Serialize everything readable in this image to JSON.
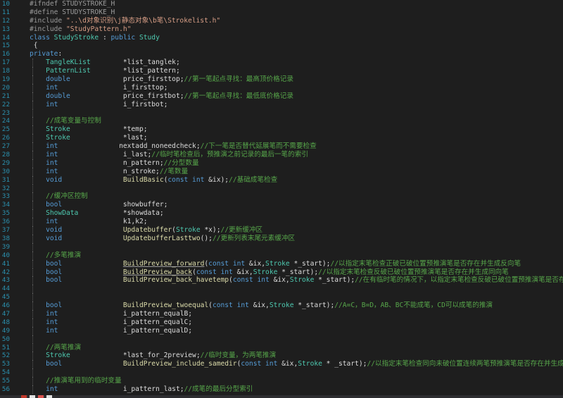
{
  "editor": {
    "lines": [
      {
        "num": "10",
        "guides": [],
        "tokens": [
          [
            "t-pp",
            "#ifndef STUDYSTROKE_H"
          ]
        ]
      },
      {
        "num": "11",
        "guides": [],
        "tokens": [
          [
            "t-pp",
            "#define STUDYSTROKE_H"
          ]
        ]
      },
      {
        "num": "12",
        "guides": [],
        "tokens": [
          [
            "t-pp",
            "#include "
          ],
          [
            "t-str",
            "\"..\\d对象识别\\j静态对象\\b笔\\Strokelist.h\""
          ]
        ]
      },
      {
        "num": "13",
        "guides": [],
        "tokens": [
          [
            "t-pp",
            "#include "
          ],
          [
            "t-str",
            "\"StudyPattern.h\""
          ]
        ]
      },
      {
        "num": "14",
        "guides": [],
        "tokens": [
          [
            "t-kw",
            "class "
          ],
          [
            "t-type",
            "StudyStroke"
          ],
          [
            "t-plain",
            " : "
          ],
          [
            "t-kw",
            "public "
          ],
          [
            "t-type",
            "Study"
          ]
        ]
      },
      {
        "num": "15",
        "guides": [],
        "tokens": [
          [
            "t-plain",
            " {"
          ]
        ]
      },
      {
        "num": "16",
        "guides": [],
        "tokens": [
          [
            "t-kw",
            "private"
          ],
          [
            "t-plain",
            ":"
          ]
        ]
      },
      {
        "num": "17",
        "guides": [
          1
        ],
        "tokens": [
          [
            "t-plain",
            "    "
          ],
          [
            "t-type",
            "TangleKList"
          ],
          [
            "t-plain",
            "        *list_tanglek;"
          ]
        ]
      },
      {
        "num": "18",
        "guides": [
          1
        ],
        "tokens": [
          [
            "t-plain",
            "    "
          ],
          [
            "t-type",
            "PatternList"
          ],
          [
            "t-plain",
            "        *list_pattern;"
          ]
        ]
      },
      {
        "num": "19",
        "guides": [
          1
        ],
        "tokens": [
          [
            "t-plain",
            "    "
          ],
          [
            "t-kw",
            "double"
          ],
          [
            "t-plain",
            "             price_firsttop;"
          ],
          [
            "t-cmt",
            "//第一笔起点寻找：最高顶价格记录"
          ]
        ]
      },
      {
        "num": "20",
        "guides": [
          1
        ],
        "tokens": [
          [
            "t-plain",
            "    "
          ],
          [
            "t-kw",
            "int"
          ],
          [
            "t-plain",
            "                i_firsttop;"
          ]
        ]
      },
      {
        "num": "21",
        "guides": [
          1
        ],
        "tokens": [
          [
            "t-plain",
            "    "
          ],
          [
            "t-kw",
            "double"
          ],
          [
            "t-plain",
            "             price_firstbot;"
          ],
          [
            "t-cmt",
            "//第一笔起点寻找：最低底价格记录"
          ]
        ]
      },
      {
        "num": "22",
        "guides": [
          1
        ],
        "tokens": [
          [
            "t-plain",
            "    "
          ],
          [
            "t-kw",
            "int"
          ],
          [
            "t-plain",
            "                i_firstbot;"
          ]
        ]
      },
      {
        "num": "23",
        "guides": [
          1
        ],
        "tokens": []
      },
      {
        "num": "24",
        "guides": [
          1
        ],
        "tokens": [
          [
            "t-plain",
            "    "
          ],
          [
            "t-cmt",
            "//成笔变量与控制"
          ]
        ]
      },
      {
        "num": "25",
        "guides": [
          1
        ],
        "tokens": [
          [
            "t-plain",
            "    "
          ],
          [
            "t-type",
            "Stroke"
          ],
          [
            "t-plain",
            "             *temp;"
          ]
        ]
      },
      {
        "num": "26",
        "guides": [
          1
        ],
        "tokens": [
          [
            "t-plain",
            "    "
          ],
          [
            "t-type",
            "Stroke"
          ],
          [
            "t-plain",
            "             *last;"
          ]
        ]
      },
      {
        "num": "27",
        "guides": [
          1
        ],
        "tokens": [
          [
            "t-plain",
            "    "
          ],
          [
            "t-kw",
            "int"
          ],
          [
            "t-plain",
            "               nextadd_noneedcheck;"
          ],
          [
            "t-cmt",
            "//下一笔是否替代延展笔而不需要检查"
          ]
        ]
      },
      {
        "num": "28",
        "guides": [
          1
        ],
        "tokens": [
          [
            "t-plain",
            "    "
          ],
          [
            "t-kw",
            "int"
          ],
          [
            "t-plain",
            "                i_last;"
          ],
          [
            "t-cmt",
            "//临时笔检查后，预推演之前记录的最后一笔的索引"
          ]
        ]
      },
      {
        "num": "29",
        "guides": [
          1
        ],
        "tokens": [
          [
            "t-plain",
            "    "
          ],
          [
            "t-kw",
            "int"
          ],
          [
            "t-plain",
            "                n_pattern;"
          ],
          [
            "t-cmt",
            "//分型数量"
          ]
        ]
      },
      {
        "num": "30",
        "guides": [
          1
        ],
        "tokens": [
          [
            "t-plain",
            "    "
          ],
          [
            "t-kw",
            "int"
          ],
          [
            "t-plain",
            "                n_stroke;"
          ],
          [
            "t-cmt",
            "//笔数量"
          ]
        ]
      },
      {
        "num": "31",
        "guides": [
          1
        ],
        "tokens": [
          [
            "t-plain",
            "    "
          ],
          [
            "t-kw",
            "void"
          ],
          [
            "t-plain",
            "               "
          ],
          [
            "t-fn",
            "BuildBasic"
          ],
          [
            "t-plain",
            "("
          ],
          [
            "t-kw",
            "const int"
          ],
          [
            "t-plain",
            " &ix);"
          ],
          [
            "t-cmt",
            "//基础成笔检查"
          ]
        ]
      },
      {
        "num": "32",
        "guides": [
          1
        ],
        "tokens": []
      },
      {
        "num": "33",
        "guides": [
          1
        ],
        "tokens": [
          [
            "t-plain",
            "    "
          ],
          [
            "t-cmt",
            "//缓冲区控制"
          ]
        ]
      },
      {
        "num": "34",
        "guides": [
          1
        ],
        "tokens": [
          [
            "t-plain",
            "    "
          ],
          [
            "t-kw",
            "bool"
          ],
          [
            "t-plain",
            "               showbuffer;"
          ]
        ]
      },
      {
        "num": "35",
        "guides": [
          1
        ],
        "tokens": [
          [
            "t-plain",
            "    "
          ],
          [
            "t-type",
            "ShowData"
          ],
          [
            "t-plain",
            "           *showdata;"
          ]
        ]
      },
      {
        "num": "36",
        "guides": [
          1
        ],
        "tokens": [
          [
            "t-plain",
            "    "
          ],
          [
            "t-kw",
            "int"
          ],
          [
            "t-plain",
            "                k1,k2;"
          ]
        ]
      },
      {
        "num": "37",
        "guides": [
          1
        ],
        "tokens": [
          [
            "t-plain",
            "    "
          ],
          [
            "t-kw",
            "void"
          ],
          [
            "t-plain",
            "               "
          ],
          [
            "t-fn",
            "Updatebuffer"
          ],
          [
            "t-plain",
            "("
          ],
          [
            "t-type",
            "Stroke"
          ],
          [
            "t-plain",
            " *x);"
          ],
          [
            "t-cmt",
            "//更新缓冲区"
          ]
        ]
      },
      {
        "num": "38",
        "guides": [
          1
        ],
        "tokens": [
          [
            "t-plain",
            "    "
          ],
          [
            "t-kw",
            "void"
          ],
          [
            "t-plain",
            "               "
          ],
          [
            "t-fn",
            "UpdatebufferLasttwo"
          ],
          [
            "t-plain",
            "();"
          ],
          [
            "t-cmt",
            "//更新列表末尾元素缓冲区"
          ]
        ]
      },
      {
        "num": "39",
        "guides": [
          1
        ],
        "tokens": []
      },
      {
        "num": "40",
        "guides": [
          1
        ],
        "tokens": [
          [
            "t-plain",
            "    "
          ],
          [
            "t-cmt",
            "//多笔推演"
          ]
        ]
      },
      {
        "num": "41",
        "guides": [
          1
        ],
        "tokens": [
          [
            "t-plain",
            "    "
          ],
          [
            "t-kw",
            "bool"
          ],
          [
            "t-plain",
            "               "
          ],
          [
            "t-fnu",
            "BuildPreview_forward"
          ],
          [
            "t-plain",
            "("
          ],
          [
            "t-kw",
            "const int"
          ],
          [
            "t-plain",
            " &ix,"
          ],
          [
            "t-type",
            "Stroke"
          ],
          [
            "t-plain",
            " *_start);"
          ],
          [
            "t-cmt",
            "//以指定末笔检查正破已破位置预推演笔是否存在并生成反向笔"
          ]
        ]
      },
      {
        "num": "42",
        "guides": [
          1
        ],
        "tokens": [
          [
            "t-plain",
            "    "
          ],
          [
            "t-kw",
            "bool"
          ],
          [
            "t-plain",
            "               "
          ],
          [
            "t-fnu",
            "BuildPreview_back"
          ],
          [
            "t-plain",
            "("
          ],
          [
            "t-kw",
            "const int"
          ],
          [
            "t-plain",
            " &ix,"
          ],
          [
            "t-type",
            "Stroke"
          ],
          [
            "t-plain",
            " *_start);"
          ],
          [
            "t-cmt",
            "//以指定末笔检查反破已破位置预推演笔是否存在并生成同向笔"
          ]
        ]
      },
      {
        "num": "43",
        "guides": [
          1
        ],
        "tokens": [
          [
            "t-plain",
            "    "
          ],
          [
            "t-kw",
            "bool"
          ],
          [
            "t-plain",
            "               "
          ],
          [
            "t-fn",
            "BuildPreview_back_havetemp"
          ],
          [
            "t-plain",
            "("
          ],
          [
            "t-kw",
            "const int"
          ],
          [
            "t-plain",
            " &ix,"
          ],
          [
            "t-type",
            "Stroke"
          ],
          [
            "t-plain",
            " *_start);"
          ],
          [
            "t-cmt",
            "//在有临时笔的情况下，以指定末笔检查反破已破位置预推演笔是否存在并生成同向笔"
          ]
        ]
      },
      {
        "num": "44",
        "guides": [
          1
        ],
        "tokens": []
      },
      {
        "num": "45",
        "guides": [
          1
        ],
        "tokens": []
      },
      {
        "num": "46",
        "guides": [
          1
        ],
        "tokens": [
          [
            "t-plain",
            "    "
          ],
          [
            "t-kw",
            "bool"
          ],
          [
            "t-plain",
            "               "
          ],
          [
            "t-fn",
            "BuildPreview_twoequal"
          ],
          [
            "t-plain",
            "("
          ],
          [
            "t-kw",
            "const int"
          ],
          [
            "t-plain",
            " &ix,"
          ],
          [
            "t-type",
            "Stroke"
          ],
          [
            "t-plain",
            " *_start);"
          ],
          [
            "t-cmt",
            "//A=C，B=D，AB、BC不能成笔，CD可以成笔的推演"
          ]
        ]
      },
      {
        "num": "47",
        "guides": [
          1
        ],
        "tokens": [
          [
            "t-plain",
            "    "
          ],
          [
            "t-kw",
            "int"
          ],
          [
            "t-plain",
            "                i_pattern_equalB;"
          ]
        ]
      },
      {
        "num": "48",
        "guides": [
          1
        ],
        "tokens": [
          [
            "t-plain",
            "    "
          ],
          [
            "t-kw",
            "int"
          ],
          [
            "t-plain",
            "                i_pattern_equalC;"
          ]
        ]
      },
      {
        "num": "49",
        "guides": [
          1
        ],
        "tokens": [
          [
            "t-plain",
            "    "
          ],
          [
            "t-kw",
            "int"
          ],
          [
            "t-plain",
            "                i_pattern_equalD;"
          ]
        ]
      },
      {
        "num": "50",
        "guides": [
          1
        ],
        "tokens": []
      },
      {
        "num": "51",
        "guides": [
          1
        ],
        "tokens": [
          [
            "t-plain",
            "    "
          ],
          [
            "t-cmt",
            "//两笔推演"
          ]
        ]
      },
      {
        "num": "52",
        "guides": [
          1
        ],
        "tokens": [
          [
            "t-plain",
            "    "
          ],
          [
            "t-type",
            "Stroke"
          ],
          [
            "t-plain",
            "             *last_for_2preview;"
          ],
          [
            "t-cmt",
            "//临时变量，为两笔推演"
          ]
        ]
      },
      {
        "num": "53",
        "guides": [
          1
        ],
        "tokens": [
          [
            "t-plain",
            "    "
          ],
          [
            "t-kw",
            "bool"
          ],
          [
            "t-plain",
            "               "
          ],
          [
            "t-fn",
            "BuildPreview_include_samedir"
          ],
          [
            "t-plain",
            "("
          ],
          [
            "t-kw",
            "const int"
          ],
          [
            "t-plain",
            " &ix,"
          ],
          [
            "t-type",
            "Stroke"
          ],
          [
            "t-plain",
            " * _start);"
          ],
          [
            "t-cmt",
            "//以指定末笔检查同向未破位置连续两笔预推演笔是否存在并生成"
          ]
        ]
      },
      {
        "num": "54",
        "guides": [
          1
        ],
        "tokens": []
      },
      {
        "num": "55",
        "guides": [
          1
        ],
        "tokens": [
          [
            "t-plain",
            "    "
          ],
          [
            "t-cmt",
            "//推演笔用到的临时变量"
          ]
        ]
      },
      {
        "num": "56",
        "guides": [
          1
        ],
        "tokens": [
          [
            "t-plain",
            "    "
          ],
          [
            "t-kw",
            "int"
          ],
          [
            "t-plain",
            "                i_pattern_last;"
          ],
          [
            "t-cmt",
            "//成笔的最后分型索引"
          ]
        ]
      }
    ]
  },
  "statusbar": {
    "chips": [
      {
        "color": "#c0392b"
      },
      {
        "color": "#e0e0e0"
      },
      {
        "color": "#d9534f"
      },
      {
        "color": "#e0e0e0"
      }
    ]
  }
}
